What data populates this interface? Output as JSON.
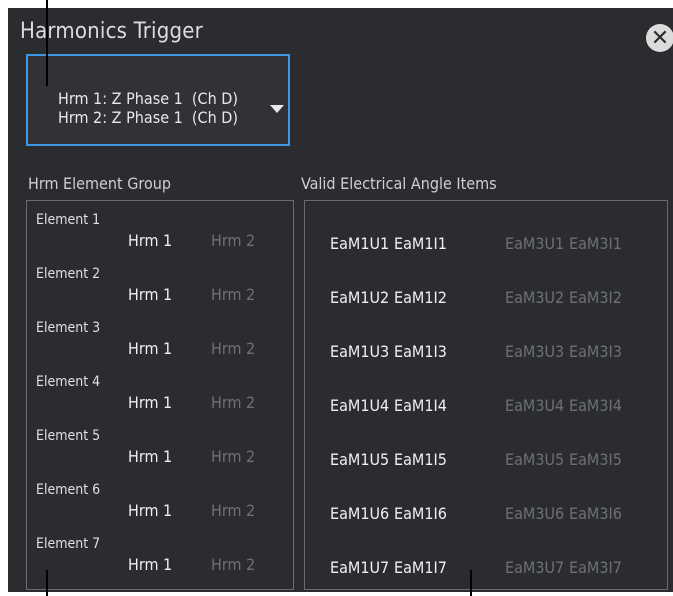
{
  "dialog": {
    "title": "Harmonics Trigger"
  },
  "trigger_select": {
    "line1": "Hrm 1: Z Phase 1  (Ch D)",
    "line2": "Hrm 2: Z Phase 1  (Ch D)"
  },
  "element_group": {
    "label": "Hrm Element Group",
    "hrm_on_label": "Hrm 1",
    "hrm_off_label": "Hrm 2",
    "elements": [
      {
        "name": "Element 1"
      },
      {
        "name": "Element 2"
      },
      {
        "name": "Element 3"
      },
      {
        "name": "Element 4"
      },
      {
        "name": "Element 5"
      },
      {
        "name": "Element 6"
      },
      {
        "name": "Element 7"
      }
    ]
  },
  "angle_items": {
    "label": "Valid Electrical Angle Items",
    "rows": [
      {
        "u1": "EaM1U1",
        "i1": "EaM1I1",
        "u3": "EaM3U1",
        "i3": "EaM3I1"
      },
      {
        "u1": "EaM1U2",
        "i1": "EaM1I2",
        "u3": "EaM3U2",
        "i3": "EaM3I2"
      },
      {
        "u1": "EaM1U3",
        "i1": "EaM1I3",
        "u3": "EaM3U3",
        "i3": "EaM3I3"
      },
      {
        "u1": "EaM1U4",
        "i1": "EaM1I4",
        "u3": "EaM3U4",
        "i3": "EaM3I4"
      },
      {
        "u1": "EaM1U5",
        "i1": "EaM1I5",
        "u3": "EaM3U5",
        "i3": "EaM3I5"
      },
      {
        "u1": "EaM1U6",
        "i1": "EaM1I6",
        "u3": "EaM3U6",
        "i3": "EaM3I6"
      },
      {
        "u1": "EaM1U7",
        "i1": "EaM1I7",
        "u3": "EaM3U7",
        "i3": "EaM3I7"
      }
    ]
  },
  "colors": {
    "background": "#2a2c30",
    "accent_border": "#3d98e6",
    "active_text": "#f0f0f0",
    "inactive_text": "#6e7074"
  }
}
